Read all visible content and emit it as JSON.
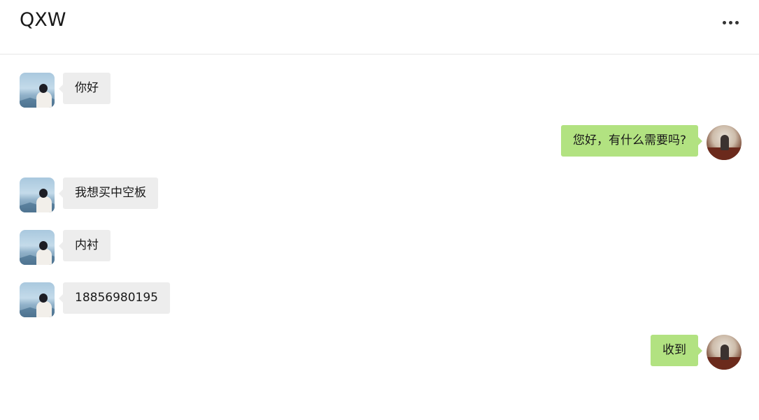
{
  "header": {
    "title": "QXW",
    "more_icon": "more-horizontal-icon"
  },
  "messages": [
    {
      "side": "left",
      "text": "你好"
    },
    {
      "side": "right",
      "text": "您好，有什么需要吗?"
    },
    {
      "side": "left",
      "text": "我想买中空板"
    },
    {
      "side": "left",
      "text": "内衬"
    },
    {
      "side": "left",
      "text": "18856980195"
    },
    {
      "side": "right",
      "text": "收到"
    }
  ],
  "colors": {
    "incoming_bubble": "#ededed",
    "outgoing_bubble": "#b2e281",
    "text": "#191919",
    "divider": "#e7e7e7"
  }
}
